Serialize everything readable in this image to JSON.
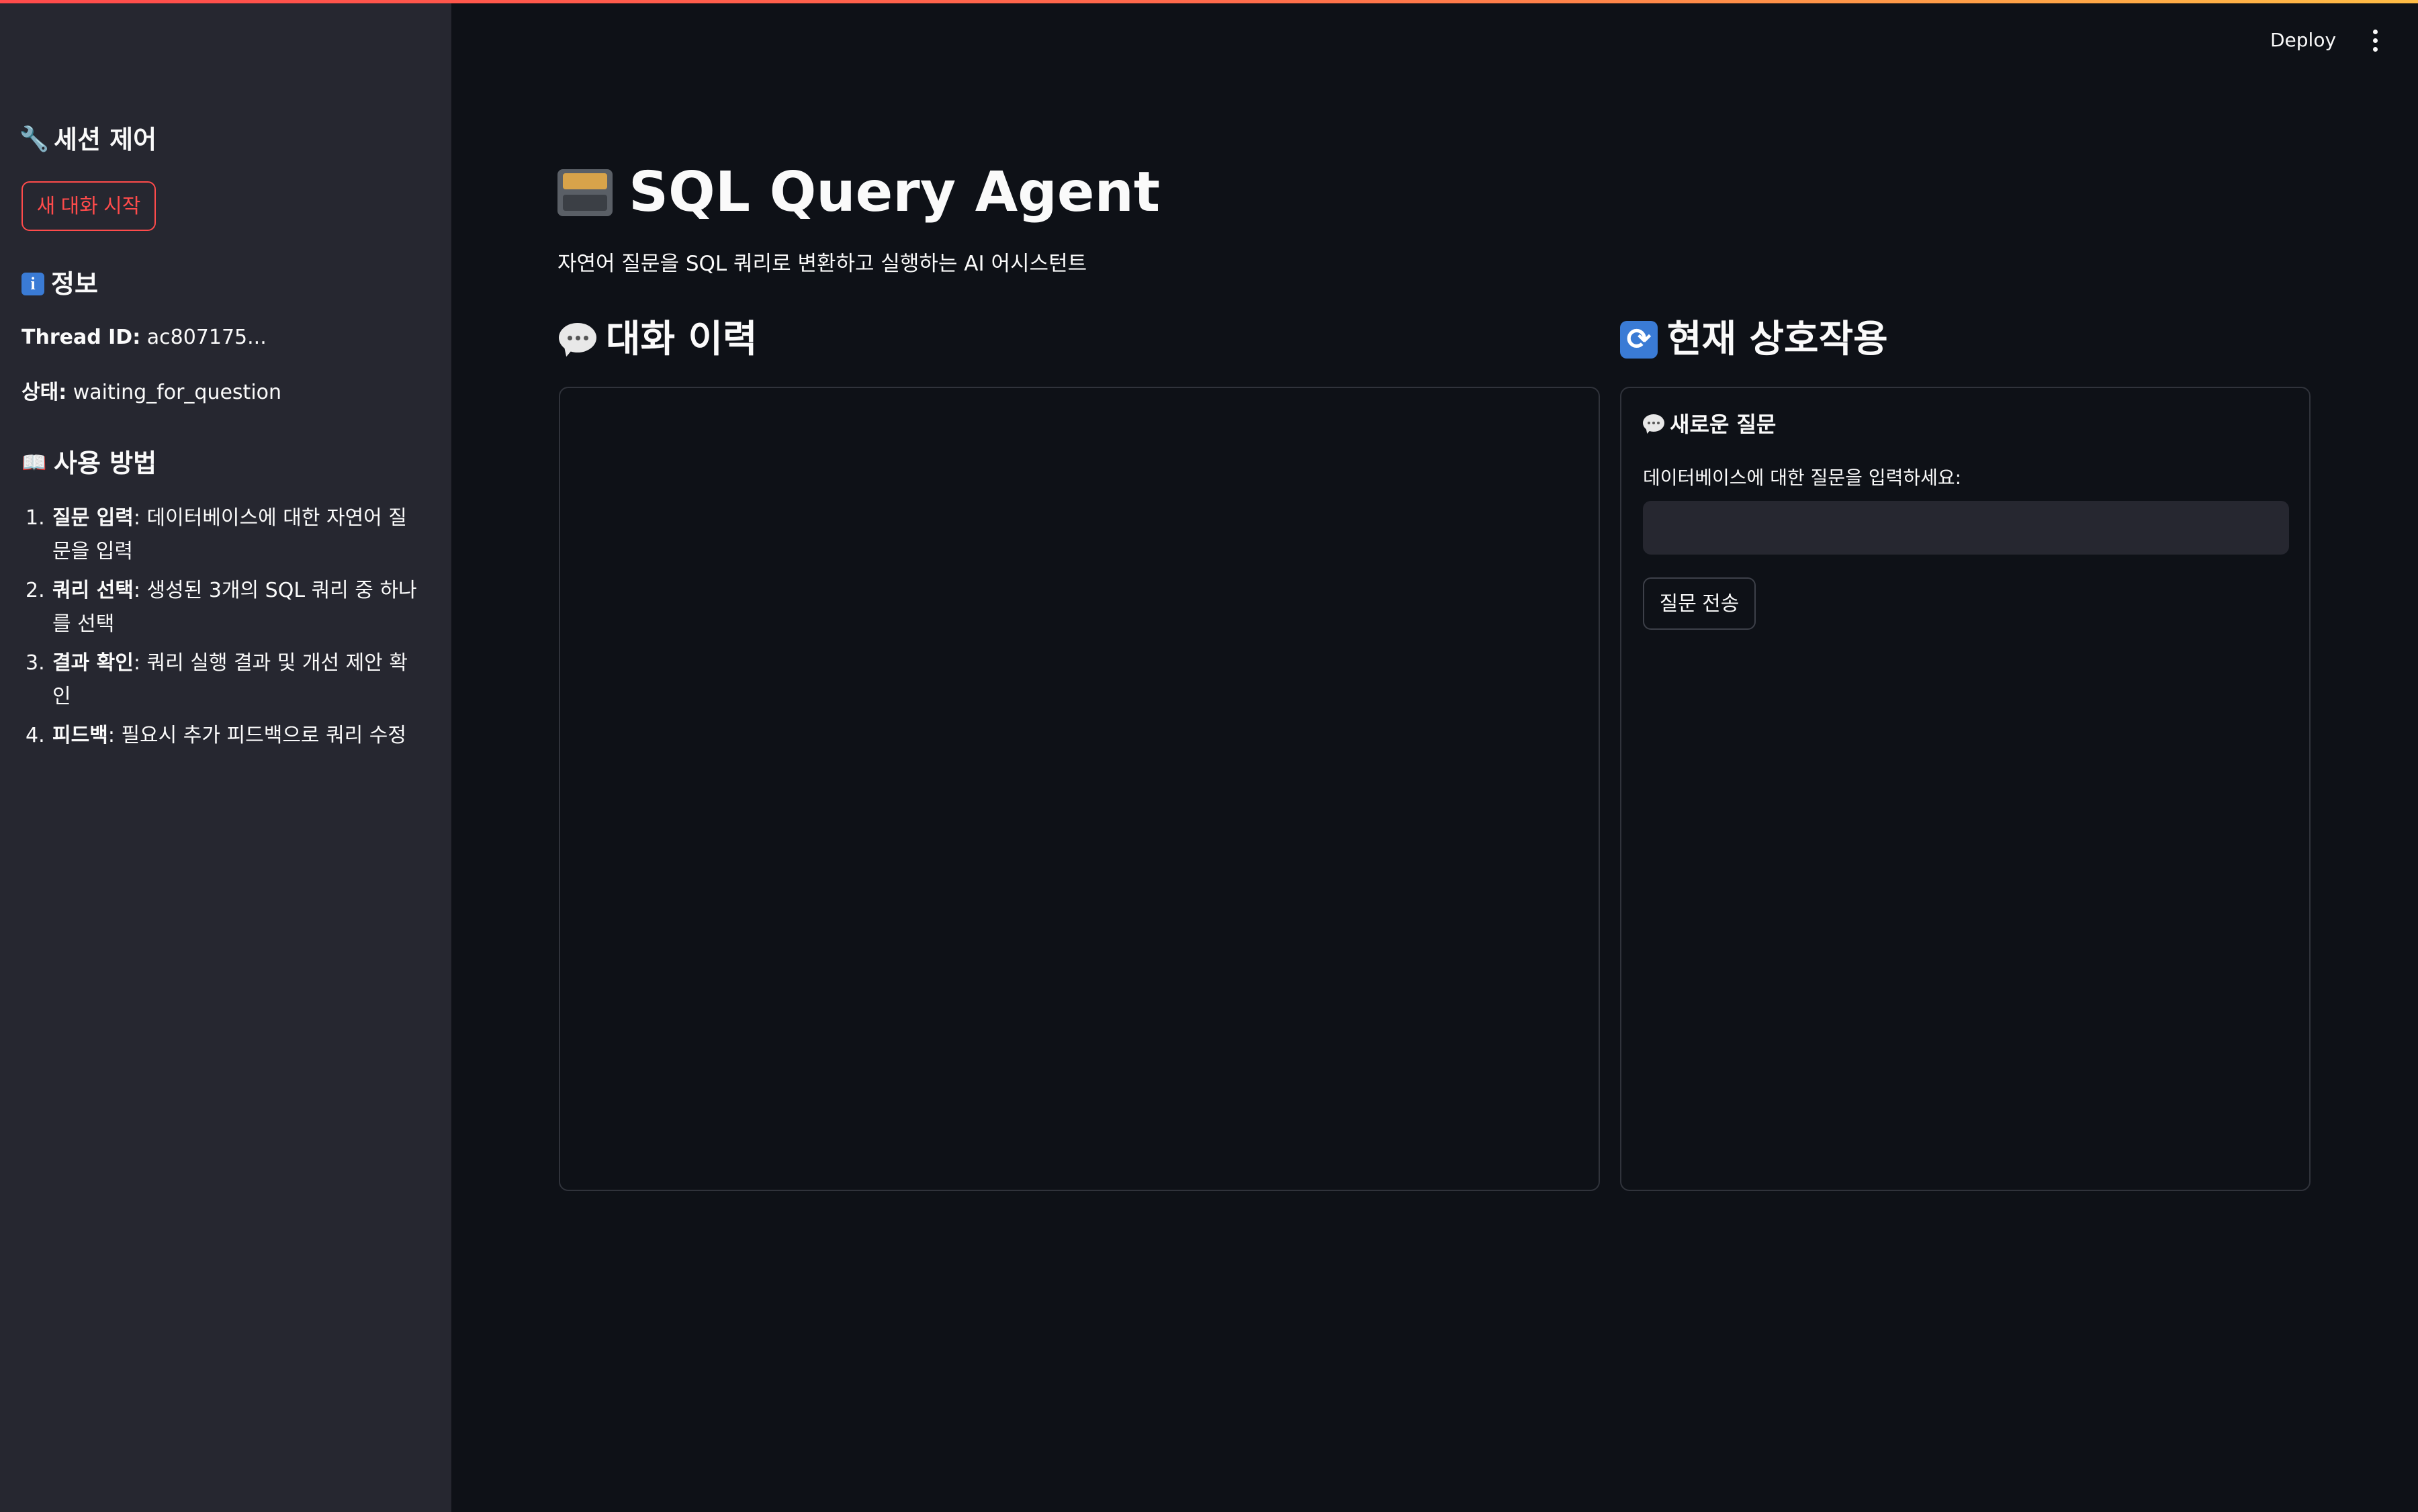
{
  "header": {
    "deploy_label": "Deploy"
  },
  "sidebar": {
    "session_heading": "세션 제어",
    "new_chat_button": "새 대화 시작",
    "info_heading": "정보",
    "thread_id_label": "Thread ID:",
    "thread_id_value": "ac807175...",
    "status_label": "상태:",
    "status_value": "waiting_for_question",
    "usage_heading": "사용 방법",
    "steps": [
      {
        "num": "1.",
        "bold": "질문 입력",
        "text": ": 데이터베이스에 대한 자연어 질문을 입력"
      },
      {
        "num": "2.",
        "bold": "쿼리 선택",
        "text": ": 생성된 3개의 SQL 쿼리 중 하나를 선택"
      },
      {
        "num": "3.",
        "bold": "결과 확인",
        "text": ": 쿼리 실행 결과 및 개선 제안 확인"
      },
      {
        "num": "4.",
        "bold": "피드백",
        "text": ": 필요시 추가 피드백으로 쿼리 수정"
      }
    ]
  },
  "main": {
    "title": "SQL Query Agent",
    "subtitle": "자연어 질문을 SQL 쿼리로 변환하고 실행하는 AI 어시스턴트",
    "history_heading": "대화 이력",
    "current_heading": "현재 상호작용",
    "new_question_heading": "새로운 질문",
    "question_label": "데이터베이스에 대한 질문을 입력하세요:",
    "question_value": "",
    "send_button": "질문 전송"
  },
  "icons": {
    "wrench": "wrench-icon",
    "info": "info-icon",
    "book": "book-icon",
    "cabinet": "file-cabinet-icon",
    "speech": "speech-bubble-icon",
    "refresh": "refresh-icon",
    "menu": "kebab-menu-icon"
  },
  "colors": {
    "accent": "#ff4b4b",
    "background": "#0e1117",
    "sidebar": "#262730",
    "text": "#fafafa"
  }
}
